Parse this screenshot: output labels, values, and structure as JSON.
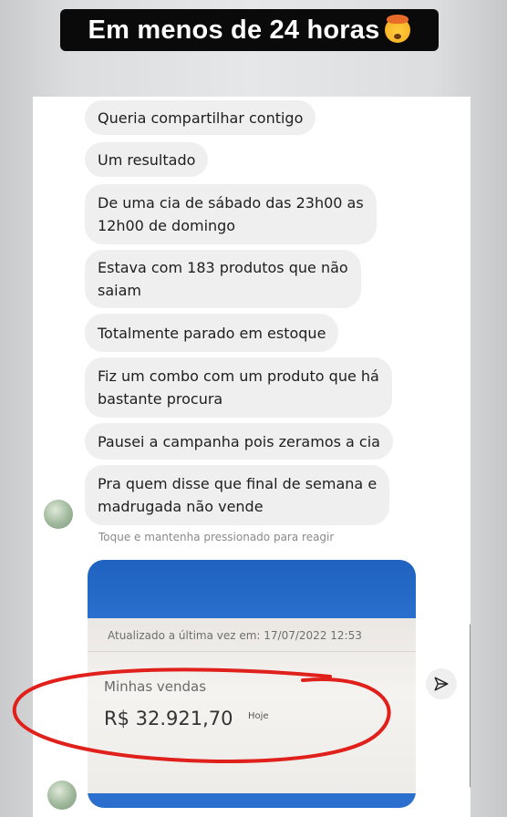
{
  "story": {
    "title": "Em menos de 24 horas",
    "title_emoji": "exploding-head-emoji"
  },
  "chat": {
    "messages": [
      {
        "text": "Queria compartilhar contigo"
      },
      {
        "text": "Um resultado"
      },
      {
        "text": "De uma cia de sábado das 23h00 as\n12h00 de domingo"
      },
      {
        "text": "Estava com 183 produtos que não\nsaiam"
      },
      {
        "text": "Totalmente parado em estoque"
      },
      {
        "text": "Fiz um combo com um produto que há\nbastante procura"
      },
      {
        "text": "Pausei a campanha pois zeramos a cia"
      },
      {
        "text": "Pra quem disse que final de semana e\nmadrugada não vende"
      }
    ],
    "reaction_hint": "Toque e mantenha pressionado para reagir",
    "shared_image": {
      "updated_text": "Atualizado a última vez em: 17/07/2022 12:53",
      "sales_label": "Minhas vendas",
      "sales_value": "R$ 32.921,70",
      "sales_period": "Hoje"
    },
    "icons": {
      "send": "send-icon",
      "avatar": "avatar"
    }
  },
  "colors": {
    "bubble_bg": "#efefef",
    "header_blue": "#2a6fcd",
    "annotation_red": "#e0201b",
    "title_bg": "#0a0a0a"
  }
}
